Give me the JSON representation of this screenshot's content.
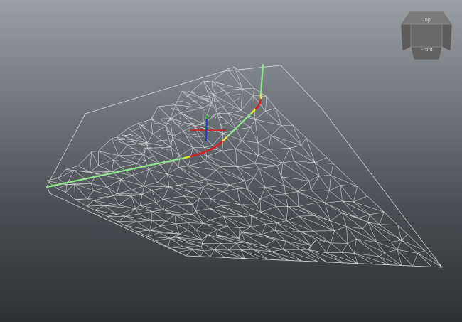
{
  "viewport": {
    "background_top": "#9aa0a5",
    "background_bottom": "#2f3032",
    "mesh_color": "#e8e8e8"
  },
  "curve": {
    "straight_color": "#8ee88e",
    "arc_color": "#e01818",
    "tangent_color": "#e8e820"
  },
  "manipulator": {
    "x_axis_color": "#d01818",
    "y_axis_color": "#18b018",
    "z_axis_color": "#1838c8"
  },
  "viewcube": {
    "top_label": "Top",
    "front_label": "Front",
    "face_color": "#6a6a6a"
  }
}
